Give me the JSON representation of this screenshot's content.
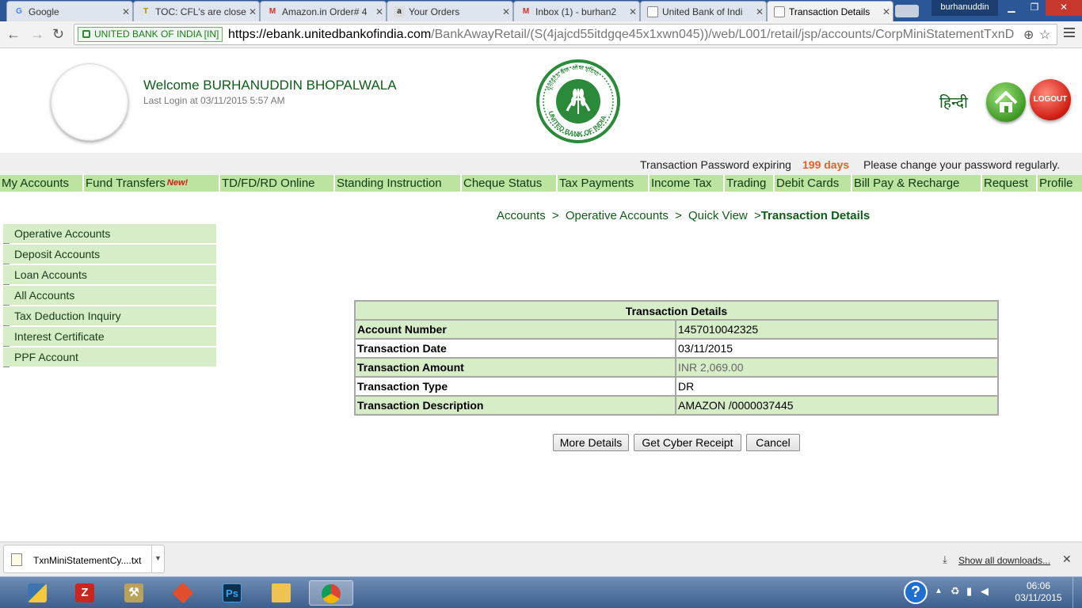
{
  "browser": {
    "tabs": [
      {
        "title": "Google",
        "favicon": "google-icon",
        "fav_text": "G",
        "fav_color": "#4285f4"
      },
      {
        "title": "TOC: CFL's are close",
        "favicon": "toc-icon",
        "fav_text": "T",
        "fav_color": "#b8860b"
      },
      {
        "title": "Amazon.in Order# 4",
        "favicon": "gmail-icon",
        "fav_text": "M",
        "fav_color": "#d93025"
      },
      {
        "title": "Your Orders",
        "favicon": "amazon-icon",
        "fav_text": "a",
        "fav_color": "#222222"
      },
      {
        "title": "Inbox (1) - burhan2",
        "favicon": "gmail-icon",
        "fav_text": "M",
        "fav_color": "#d93025"
      },
      {
        "title": "United Bank of Indi",
        "favicon": "page-icon",
        "fav_text": "",
        "fav_color": "#ffffff"
      },
      {
        "title": "Transaction Details",
        "favicon": "page-icon",
        "fav_text": "",
        "fav_color": "#ffffff"
      }
    ],
    "user": "burhanuddin",
    "secure_label": "UNITED BANK OF INDIA [IN]",
    "url_host": "https://ebank.unitedbankofindia.com",
    "url_path": "/BankAwayRetail/(S(4jajcd55itdgqe45x1xwn045))/web/L001/retail/jsp/accounts/CorpMiniStatementTxnD"
  },
  "header": {
    "welcome": "Welcome BURHANUDDIN BHOPALWALA",
    "last_login": "Last Login at 03/11/2015 5:57 AM",
    "logo_text": "UNITED BANK OF INDIA",
    "logo_hindi": "यूनाइटेड बैंक ऑफ इंडिया",
    "hindi_link": "हिन्दी",
    "logout_label": "LOGOUT"
  },
  "password_notice": {
    "prefix": "Transaction Password expiring",
    "days": "199 days",
    "suffix": "Please change your password regularly."
  },
  "top_nav": [
    {
      "label": "My Accounts"
    },
    {
      "label": "Fund Transfers",
      "badge": "New!"
    },
    {
      "label": "TD/FD/RD Online"
    },
    {
      "label": "Standing Instruction"
    },
    {
      "label": "Cheque Status"
    },
    {
      "label": "Tax Payments"
    },
    {
      "label": "Income Tax"
    },
    {
      "label": "Trading"
    },
    {
      "label": "Debit Cards"
    },
    {
      "label": "Bill Pay & Recharge"
    },
    {
      "label": "Request"
    },
    {
      "label": "Profile"
    }
  ],
  "breadcrumb": {
    "items": [
      "Accounts",
      ">",
      "Operative Accounts",
      ">",
      "Quick View",
      ">"
    ],
    "current": "Transaction Details"
  },
  "sidebar": {
    "items": [
      "Operative Accounts",
      "Deposit Accounts",
      "Loan Accounts",
      "All Accounts",
      "Tax Deduction Inquiry",
      "Interest Certificate",
      "PPF Account"
    ]
  },
  "details": {
    "title": "Transaction Details",
    "rows": [
      {
        "label": "Account Number",
        "value": "1457010042325"
      },
      {
        "label": "Transaction Date",
        "value": "03/11/2015"
      },
      {
        "label": "Transaction Amount",
        "value": "INR 2,069.00"
      },
      {
        "label": "Transaction Type",
        "value": "DR"
      },
      {
        "label": "Transaction Description",
        "value": "AMAZON /0000037445"
      }
    ]
  },
  "actions": {
    "more": "More Details",
    "receipt": "Get Cyber Receipt",
    "cancel": "Cancel"
  },
  "downloads": {
    "file": "TxnMiniStatementCy....txt",
    "show_all": "Show all downloads..."
  },
  "taskbar": {
    "time": "06:06",
    "date": "03/11/2015"
  },
  "colors": {
    "nav_bg": "#bde3a1",
    "sidebar_bg": "#d6edc7",
    "brand_green": "#0d5e17",
    "days_accent": "#e4622a"
  }
}
